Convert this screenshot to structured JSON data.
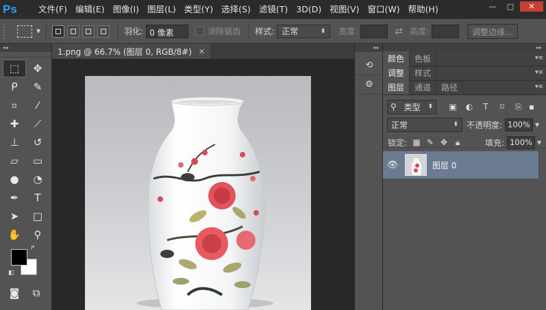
{
  "app": {
    "logo": "Ps"
  },
  "menu": [
    "文件(F)",
    "编辑(E)",
    "图像(I)",
    "图层(L)",
    "类型(Y)",
    "选择(S)",
    "滤镜(T)",
    "3D(D)",
    "视图(V)",
    "窗口(W)",
    "帮助(H)"
  ],
  "window_controls": {
    "minimize": "—",
    "restore": "□",
    "close": "✕"
  },
  "options": {
    "feather_label": "羽化:",
    "feather_value": "0 像素",
    "antialias_label": "消除锯齿",
    "style_label": "样式:",
    "style_value": "正常",
    "width_label": "宽度:",
    "height_label": "高度:",
    "refine_edge": "调整边缘..."
  },
  "tools_panel": {
    "header": "◂◂",
    "tools": [
      {
        "icon": "rect-marquee-icon",
        "glyph": "⬚",
        "active": true
      },
      {
        "icon": "move-icon",
        "glyph": "✥",
        "active": false
      },
      {
        "icon": "lasso-icon",
        "glyph": "ᑭ",
        "active": false
      },
      {
        "icon": "quick-select-icon",
        "glyph": "✎",
        "active": false
      },
      {
        "icon": "crop-icon",
        "glyph": "⌗",
        "active": false
      },
      {
        "icon": "eyedropper-icon",
        "glyph": "⁄",
        "active": false
      },
      {
        "icon": "healing-brush-icon",
        "glyph": "✚",
        "active": false
      },
      {
        "icon": "brush-icon",
        "glyph": "⟋",
        "active": false
      },
      {
        "icon": "stamp-icon",
        "glyph": "⊥",
        "active": false
      },
      {
        "icon": "history-brush-icon",
        "glyph": "↺",
        "active": false
      },
      {
        "icon": "eraser-icon",
        "glyph": "▱",
        "active": false
      },
      {
        "icon": "gradient-icon",
        "glyph": "▭",
        "active": false
      },
      {
        "icon": "blur-icon",
        "glyph": "●",
        "active": false
      },
      {
        "icon": "dodge-icon",
        "glyph": "◔",
        "active": false
      },
      {
        "icon": "pen-icon",
        "glyph": "✒",
        "active": false
      },
      {
        "icon": "type-icon",
        "glyph": "T",
        "active": false
      },
      {
        "icon": "path-select-icon",
        "glyph": "➤",
        "active": false
      },
      {
        "icon": "shape-icon",
        "glyph": "□",
        "active": false
      },
      {
        "icon": "hand-icon",
        "glyph": "✋",
        "active": false
      },
      {
        "icon": "zoom-icon",
        "glyph": "⚲",
        "active": false
      }
    ],
    "foreground_color": "#000000",
    "background_color": "#ffffff"
  },
  "document": {
    "tab_title": "1.png @ 66.7% (图层 0, RGB/8#)",
    "close": "✕"
  },
  "panels": {
    "top_tabs": [
      {
        "labels": [
          "颜色",
          "色板"
        ]
      },
      {
        "labels": [
          "调整",
          "样式"
        ]
      }
    ],
    "layers_tabs": [
      "图层",
      "通道",
      "路径"
    ],
    "filter_label": "类型",
    "blend_mode": "正常",
    "opacity_label": "不透明度:",
    "opacity_value": "100%",
    "lock_label": "锁定:",
    "fill_label": "填充:",
    "fill_value": "100%",
    "layer_name": "图层 0"
  },
  "colors": {
    "accent": "#2da0f0",
    "selected_layer": "#6b7b91",
    "close_button": "#c74032"
  }
}
